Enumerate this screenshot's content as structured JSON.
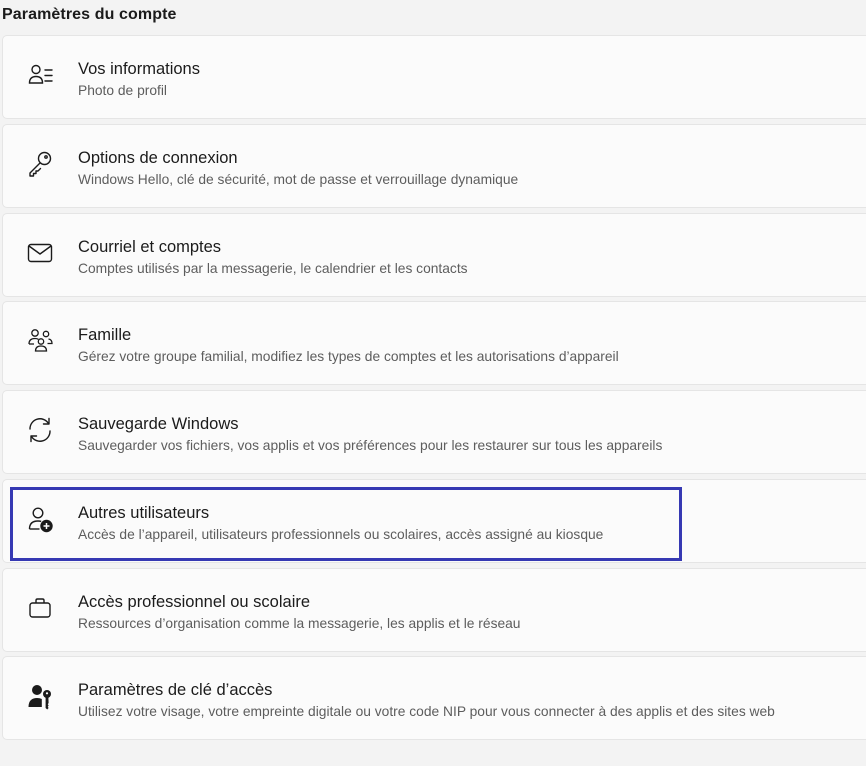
{
  "page": {
    "title": "Paramètres du compte"
  },
  "items": [
    {
      "icon": "user-info-icon",
      "title": "Vos informations",
      "subtitle": "Photo de profil"
    },
    {
      "icon": "key-icon",
      "title": "Options de connexion",
      "subtitle": "Windows Hello, clé de sécurité, mot de passe et verrouillage dynamique"
    },
    {
      "icon": "mail-icon",
      "title": "Courriel et comptes",
      "subtitle": "Comptes utilisés par la messagerie, le calendrier et les contacts"
    },
    {
      "icon": "family-icon",
      "title": "Famille",
      "subtitle": "Gérez votre groupe familial, modifiez les types de comptes et les autorisations d’appareil"
    },
    {
      "icon": "sync-icon",
      "title": "Sauvegarde Windows",
      "subtitle": "Sauvegarder vos fichiers, vos applis et vos préférences pour les restaurer sur tous les appareils"
    },
    {
      "icon": "add-user-icon",
      "title": "Autres utilisateurs",
      "subtitle": "Accès de l’appareil, utilisateurs professionnels ou scolaires, accès assigné au kiosque"
    },
    {
      "icon": "briefcase-icon",
      "title": "Accès professionnel ou scolaire",
      "subtitle": "Ressources d’organisation comme la messagerie, les applis et le réseau"
    },
    {
      "icon": "passkey-icon",
      "title": "Paramètres de clé d’accès",
      "subtitle": "Utilisez votre visage, votre empreinte digitale ou votre code NIP pour vous connecter à des applis et des sites web"
    }
  ],
  "highlight": {
    "color": "#3639b3",
    "target": "Autres utilisateurs"
  }
}
